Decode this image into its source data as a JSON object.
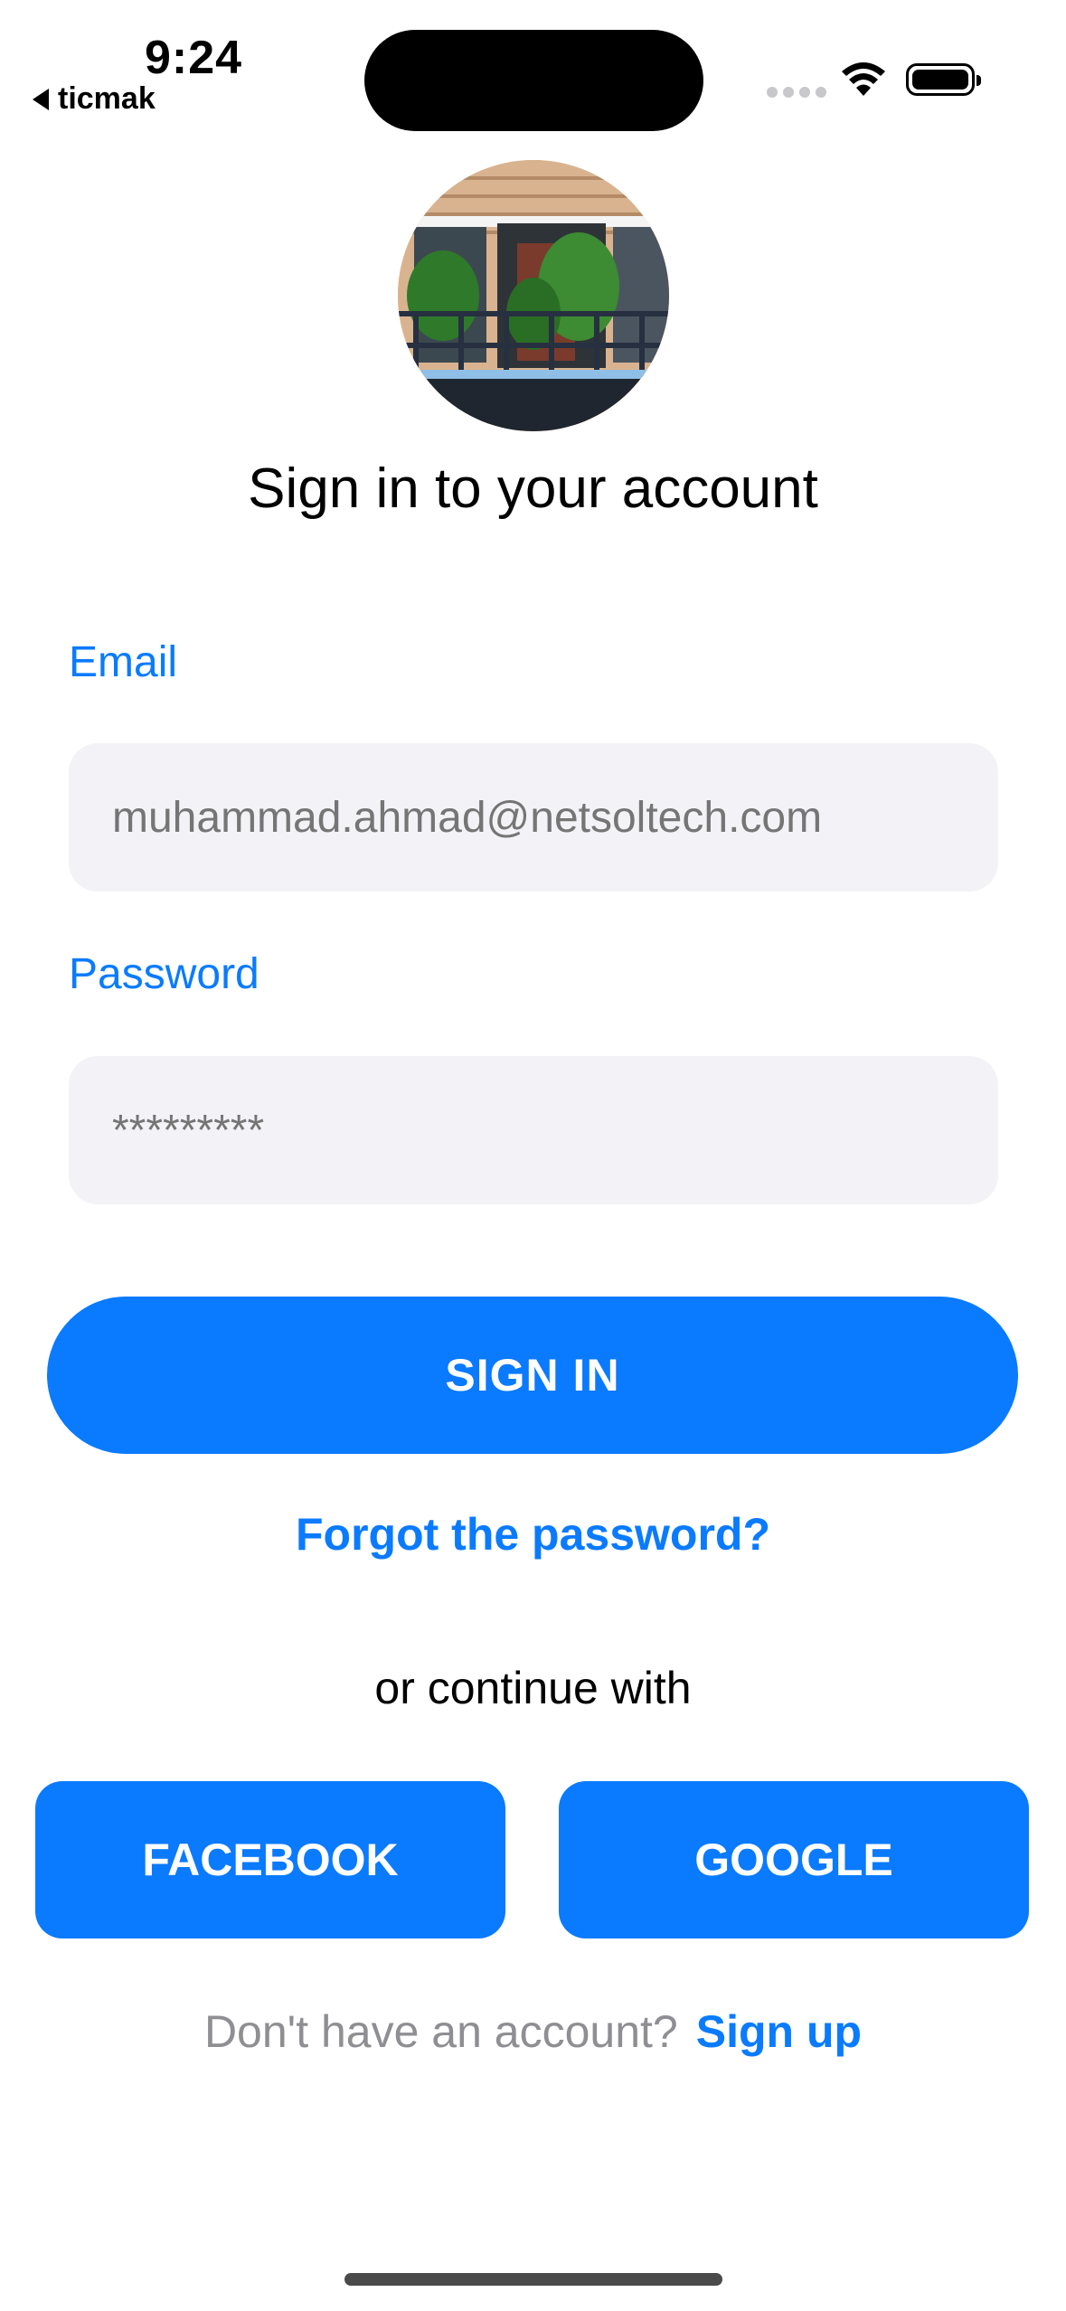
{
  "status_bar": {
    "time": "9:24",
    "back_app": "ticmak"
  },
  "header": {
    "title": "Sign in to your account"
  },
  "form": {
    "email_label": "Email",
    "email_placeholder": "muhammad.ahmad@netsoltech.com",
    "password_label": "Password",
    "password_placeholder": "*********"
  },
  "actions": {
    "sign_in": "SIGN IN",
    "forgot": "Forgot the password?",
    "or_continue": "or continue with",
    "facebook": "FACEBOOK",
    "google": "GOOGLE"
  },
  "footer": {
    "prompt": "Don't have an account?",
    "sign_up": "Sign up"
  },
  "colors": {
    "accent": "#0a7aff",
    "field_bg": "#f3f3f7",
    "muted": "#8e8e93"
  }
}
